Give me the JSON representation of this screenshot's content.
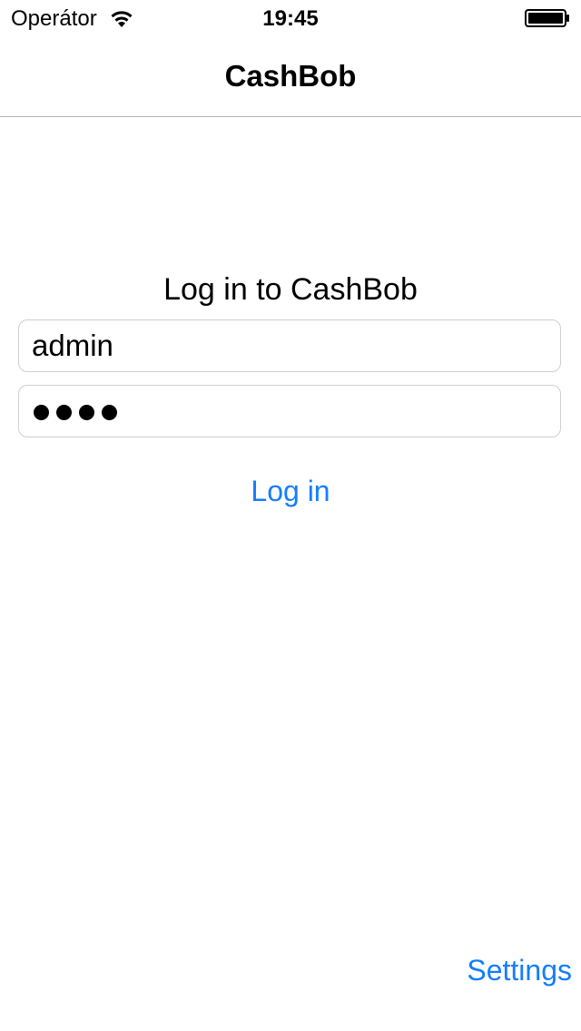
{
  "status_bar": {
    "carrier": "Operátor",
    "time": "19:45",
    "wifi_icon": "wifi-icon",
    "battery_icon": "battery-icon"
  },
  "nav": {
    "title": "CashBob"
  },
  "login": {
    "heading": "Log in to CashBob",
    "username_value": "admin",
    "password_masked_length": 4,
    "login_label": "Log in"
  },
  "footer": {
    "settings_label": "Settings"
  },
  "colors": {
    "accent": "#147efb",
    "separator": "#b2b2b2",
    "field_border": "#cfcfcf"
  }
}
